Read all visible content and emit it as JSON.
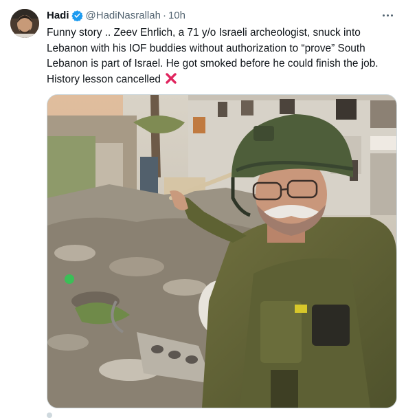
{
  "tweet": {
    "author_name": "Hadi",
    "author_handle": "@HadiNasrallah",
    "separator": "·",
    "time": "10h",
    "text": "Funny story .. Zeev Ehrlich, a 71 y/o Israeli archeologist, snuck into Lebanon with his IOF buddies without authorization to “prove” South Lebanon is part of Israel. He got smoked before he could finish the job. History lesson cancelled",
    "emoji": "cross-mark-icon"
  },
  "colors": {
    "verified_blue": "#1d9bf0",
    "cross_red": "#e0245e",
    "muted_text": "#536471",
    "border": "#cfd9de"
  }
}
